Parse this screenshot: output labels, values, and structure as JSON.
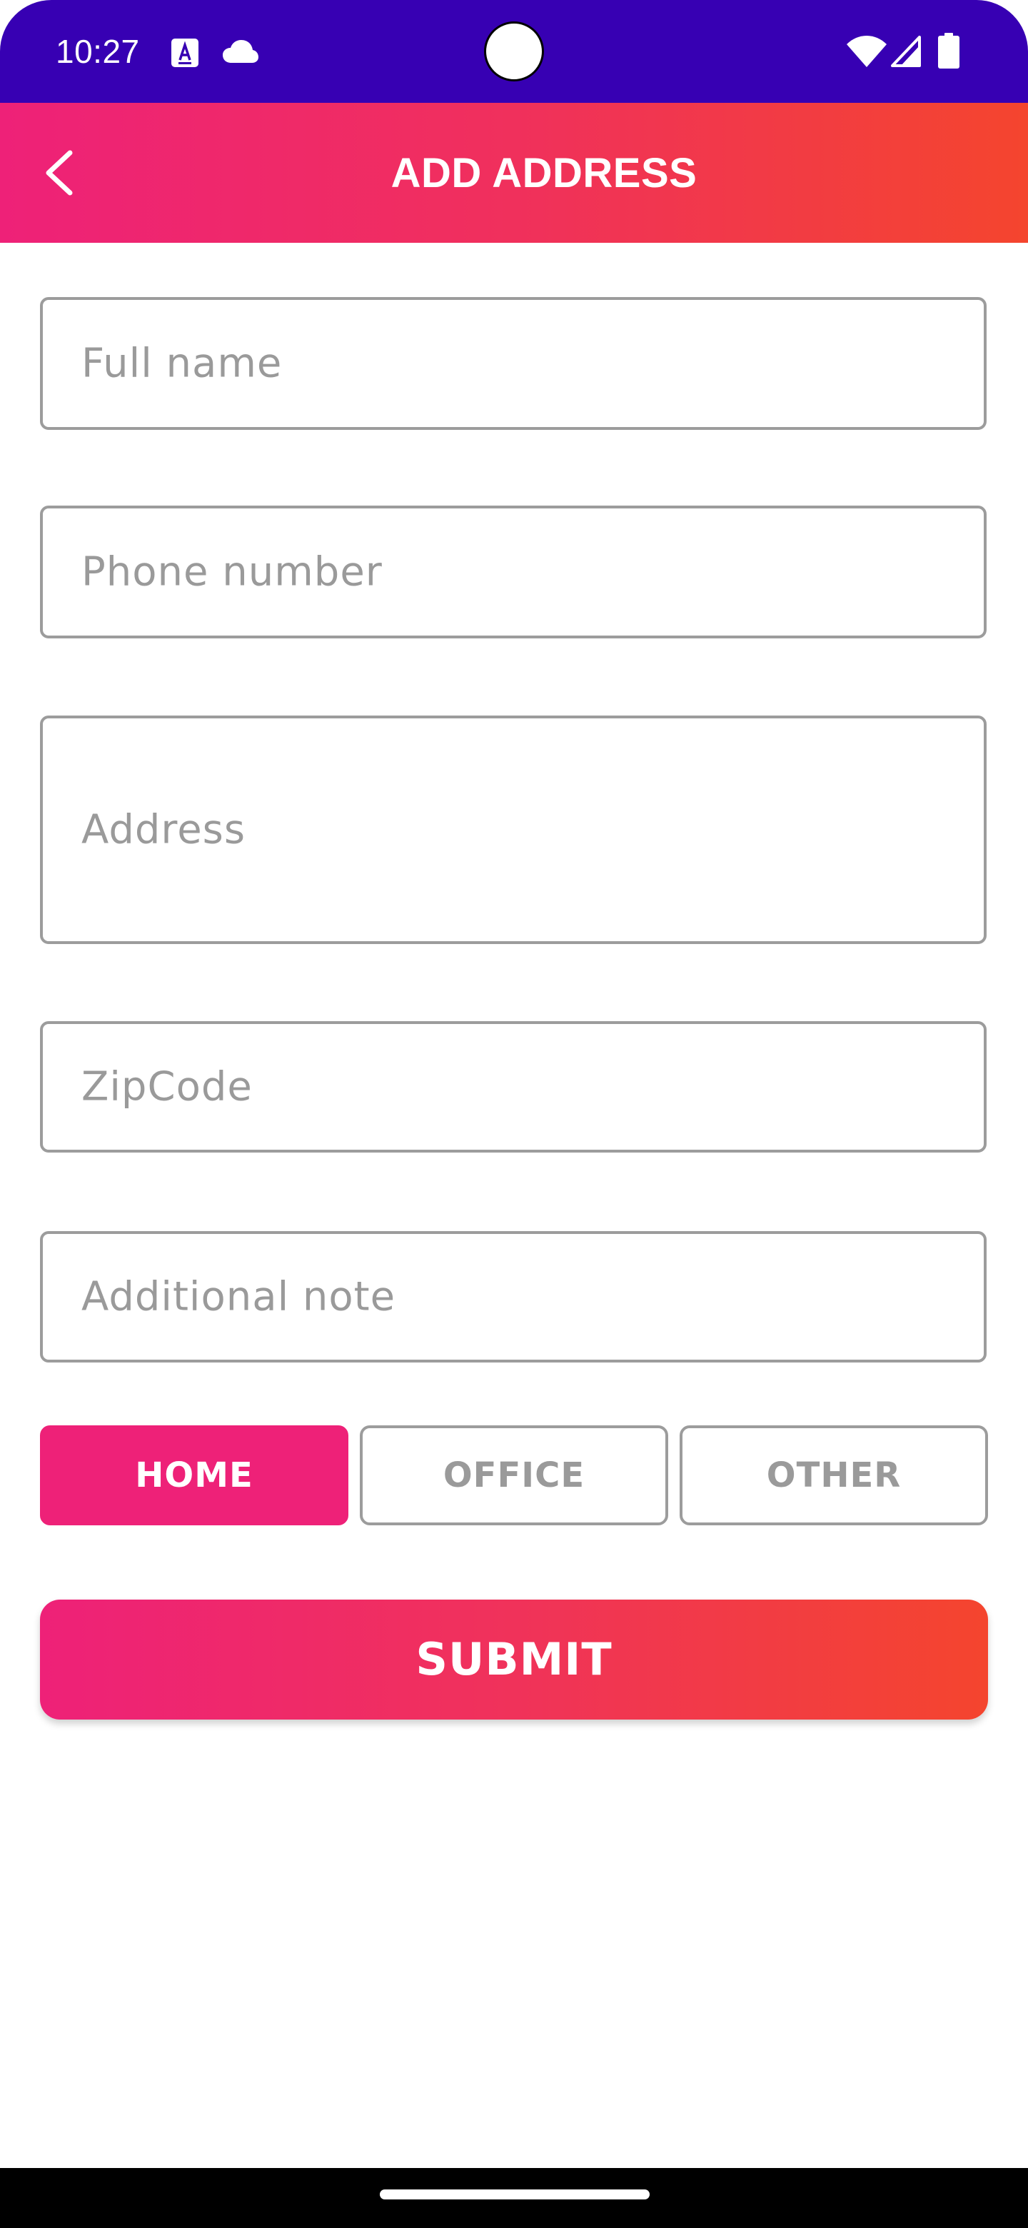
{
  "status_bar": {
    "time": "10:27",
    "icons": [
      "accessibility-a-icon",
      "cloud-icon",
      "wifi-icon",
      "signal-icon",
      "battery-icon"
    ],
    "background": "#3700b3"
  },
  "toolbar": {
    "title": "ADD ADDRESS",
    "back_icon": "chevron-left-icon",
    "gradient": [
      "#ee2178",
      "#f4452e"
    ]
  },
  "form": {
    "full_name": {
      "placeholder": "Full name",
      "value": ""
    },
    "phone": {
      "placeholder": "Phone number",
      "value": ""
    },
    "address": {
      "placeholder": "Address",
      "value": ""
    },
    "zipcode": {
      "placeholder": "ZipCode",
      "value": ""
    },
    "note": {
      "placeholder": "Additional note",
      "value": ""
    }
  },
  "address_types": {
    "options": [
      "HOME",
      "OFFICE",
      "OTHER"
    ],
    "selected": "HOME",
    "accent": "#ee2178"
  },
  "submit": {
    "label": "SUBMIT"
  }
}
